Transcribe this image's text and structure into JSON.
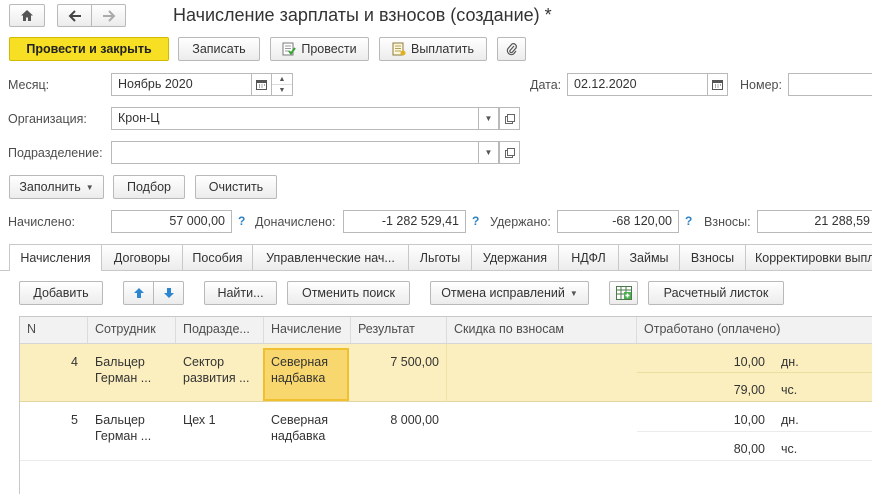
{
  "window": {
    "title": "Начисление зарплаты и взносов (создание) *"
  },
  "nav": {
    "home_icon": "home-icon",
    "back_icon": "arrow-left-icon",
    "forward_icon": "arrow-right-icon"
  },
  "toolbar": {
    "post_close": "Провести и закрыть",
    "save": "Записать",
    "post": "Провести",
    "pay": "Выплатить",
    "attach_icon": "paperclip-icon"
  },
  "form": {
    "month_label": "Месяц:",
    "month_value": "Ноябрь 2020",
    "date_label": "Дата:",
    "date_value": "02.12.2020",
    "number_label": "Номер:",
    "number_value": "",
    "org_label": "Организация:",
    "org_value": "Крон-Ц",
    "dept_label": "Подразделение:",
    "dept_value": ""
  },
  "actions": {
    "fill": "Заполнить",
    "select": "Подбор",
    "clear": "Очистить"
  },
  "totals": {
    "accrued_label": "Начислено:",
    "accrued_value": "57 000,00",
    "additional_label": "Доначислено:",
    "additional_value": "-1 282 529,41",
    "withheld_label": "Удержано:",
    "withheld_value": "-68 120,00",
    "contrib_label": "Взносы:",
    "contrib_value": "21 288,59",
    "help_mark": "?"
  },
  "tabs": [
    {
      "label": "Начисления",
      "active": true
    },
    {
      "label": "Договоры"
    },
    {
      "label": "Пособия"
    },
    {
      "label": "Управленческие нач..."
    },
    {
      "label": "Льготы"
    },
    {
      "label": "Удержания"
    },
    {
      "label": "НДФЛ"
    },
    {
      "label": "Займы"
    },
    {
      "label": "Взносы"
    },
    {
      "label": "Корректировки выпл"
    }
  ],
  "table_toolbar": {
    "add": "Добавить",
    "up_icon": "arrow-up-icon",
    "down_icon": "arrow-down-icon",
    "find": "Найти...",
    "cancel_search": "Отменить поиск",
    "cancel_corrections": "Отмена исправлений",
    "grid_icon": "table-settings-icon",
    "payslip": "Расчетный листок"
  },
  "table": {
    "columns": [
      "N",
      "Сотрудник",
      "Подразде...",
      "Начисление",
      "Результат",
      "Скидка по взносам",
      "Отработано (оплачено)"
    ],
    "rows": [
      {
        "n": "4",
        "employee": [
          "Бальцер",
          "Герман ..."
        ],
        "dept": [
          "Сектор",
          "развития ..."
        ],
        "accrual": [
          "Северная",
          "надбавка"
        ],
        "result": "7 500,00",
        "discount": "",
        "days": "10,00",
        "days_unit": "дн.",
        "hours": "79,00",
        "hours_unit": "чс.",
        "selected": true
      },
      {
        "n": "5",
        "employee": [
          "Бальцер",
          "Герман ..."
        ],
        "dept": [
          "Цех 1",
          ""
        ],
        "accrual": [
          "Северная",
          "надбавка"
        ],
        "result": "8 000,00",
        "discount": "",
        "days": "10,00",
        "days_unit": "дн.",
        "hours": "80,00",
        "hours_unit": "чс.",
        "selected": false
      }
    ]
  },
  "colors": {
    "primary_button": "#f7df23",
    "selected_row": "#fbefbf",
    "selected_cell": "#f8d86e",
    "help_mark": "#2e83c6"
  }
}
